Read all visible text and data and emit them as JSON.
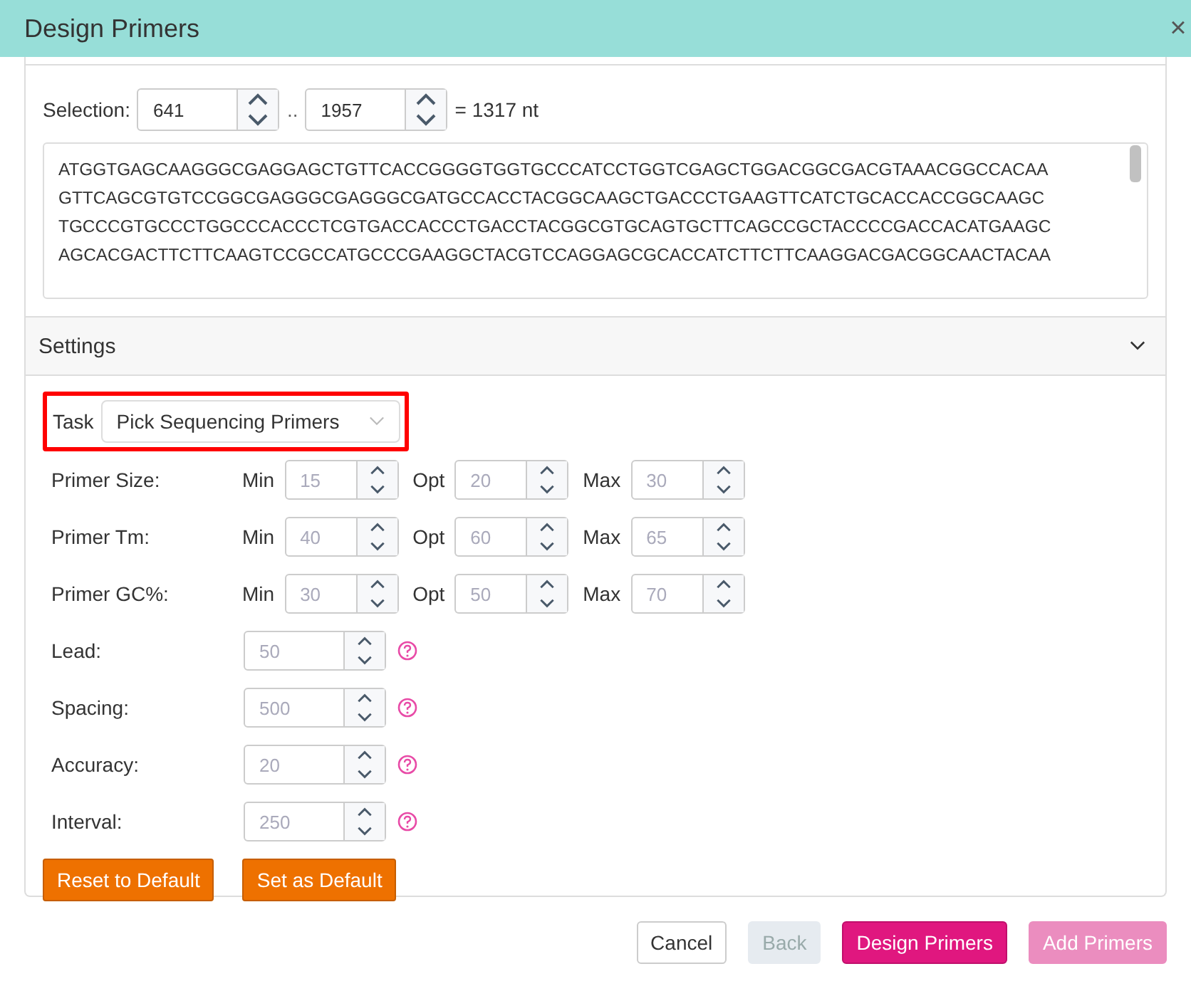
{
  "window": {
    "title": "Design Primers",
    "close": "×"
  },
  "selection": {
    "label": "Selection:",
    "start": "641",
    "separator": "..",
    "end": "1957",
    "length": "= 1317 nt"
  },
  "sequence_lines": [
    "ATGGTGAGCAAGGGCGAGGAGCTGTTCACCGGGGTGGTGCCCATCCTGGTCGAGCTGGACGGCGACGTAAACGGCCACAA",
    "GTTCAGCGTGTCCGGCGAGGGCGAGGGCGATGCCACCTACGGCAAGCTGACCCTGAAGTTCATCTGCACCACCGGCAAGC",
    "TGCCCGTGCCCTGGCCCACCCTCGTGACCACCCTGACCTACGGCGTGCAGTGCTTCAGCCGCTACCCCGACCACATGAAGC",
    "AGCACGACTTCTTCAAGTCCGCCATGCCCGAAGGCTACGTCCAGGAGCGCACCATCTTCTTCAAGGACGACGGCAACTACAA"
  ],
  "settings": {
    "title": "Settings",
    "expanded": true,
    "task": {
      "label": "Task",
      "value": "Pick Sequencing Primers"
    },
    "range_rows": [
      {
        "label": "Primer Size:",
        "fields": [
          {
            "label": "Min",
            "value": "15"
          },
          {
            "label": "Opt",
            "value": "20"
          },
          {
            "label": "Max",
            "value": "30"
          }
        ]
      },
      {
        "label": "Primer Tm:",
        "fields": [
          {
            "label": "Min",
            "value": "40"
          },
          {
            "label": "Opt",
            "value": "60"
          },
          {
            "label": "Max",
            "value": "65"
          }
        ]
      },
      {
        "label": "Primer GC%:",
        "fields": [
          {
            "label": "Min",
            "value": "30"
          },
          {
            "label": "Opt",
            "value": "50"
          },
          {
            "label": "Max",
            "value": "70"
          }
        ]
      }
    ],
    "single_rows": [
      {
        "label": "Lead:",
        "value": "50"
      },
      {
        "label": "Spacing:",
        "value": "500"
      },
      {
        "label": "Accuracy:",
        "value": "20"
      },
      {
        "label": "Interval:",
        "value": "250"
      }
    ],
    "buttons": [
      "Reset to Default",
      "Set as Default"
    ]
  },
  "footer_buttons": [
    {
      "label": "Cancel",
      "kind": "default",
      "disabled": false
    },
    {
      "label": "Back",
      "kind": "default",
      "disabled": true
    },
    {
      "label": "Design Primers",
      "kind": "primary",
      "disabled": false
    },
    {
      "label": "Add Primers",
      "kind": "primary",
      "disabled": true
    }
  ]
}
